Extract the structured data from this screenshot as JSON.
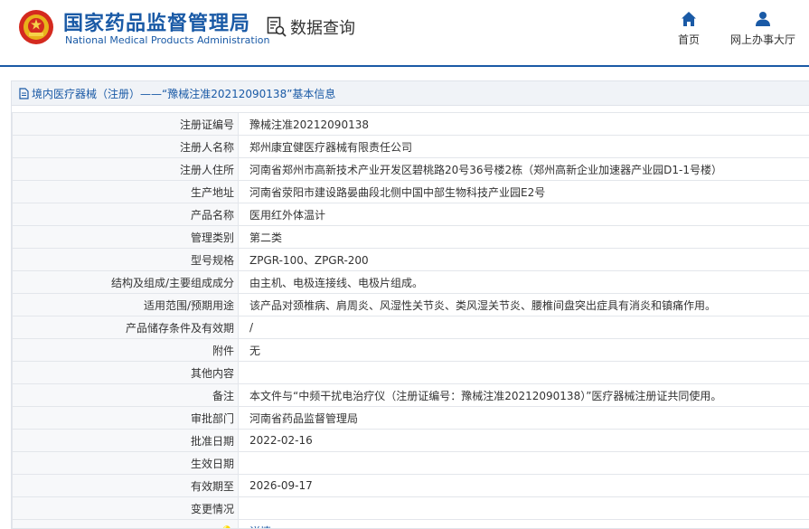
{
  "brand": {
    "name_cn": "国家药品监督管理局",
    "name_en": "National Medical Products Administration"
  },
  "header": {
    "data_query": "数据查询",
    "nav": [
      {
        "label": "首页",
        "icon": "home-icon"
      },
      {
        "label": "网上办事大厅",
        "icon": "user-icon"
      }
    ]
  },
  "panel": {
    "title": "境内医疗器械（注册）——“豫械注准20212090138”基本信息"
  },
  "colors": {
    "accent": "#1a5aa6",
    "label_bg": "#f7f8fa",
    "head_bg": "#f0f3f7"
  },
  "rows": [
    {
      "label": "注册证编号",
      "value": "豫械注准20212090138"
    },
    {
      "label": "注册人名称",
      "value": "郑州康宜健医疗器械有限责任公司"
    },
    {
      "label": "注册人住所",
      "value": "河南省郑州市高新技术产业开发区碧桃路20号36号楼2栋（郑州高新企业加速器产业园D1-1号楼）"
    },
    {
      "label": "生产地址",
      "value": "河南省荥阳市建设路晏曲段北侧中国中部生物科技产业园E2号"
    },
    {
      "label": "产品名称",
      "value": "医用红外体温计"
    },
    {
      "label": "管理类别",
      "value": "第二类"
    },
    {
      "label": "型号规格",
      "value": "ZPGR-100、ZPGR-200"
    },
    {
      "label": "结构及组成/主要组成成分",
      "value": "由主机、电极连接线、电极片组成。"
    },
    {
      "label": "适用范围/预期用途",
      "value": "该产品对颈椎病、肩周炎、风湿性关节炎、类风湿关节炎、腰椎间盘突出症具有消炎和镇痛作用。"
    },
    {
      "label": "产品储存条件及有效期",
      "value": "/"
    },
    {
      "label": "附件",
      "value": "无"
    },
    {
      "label": "其他内容",
      "value": ""
    },
    {
      "label": "备注",
      "value": "本文件与“中频干扰电治疗仪（注册证编号：豫械注准20212090138）”医疗器械注册证共同使用。"
    },
    {
      "label": "审批部门",
      "value": "河南省药品监督管理局"
    },
    {
      "label": "批准日期",
      "value": "2022-02-16"
    },
    {
      "label": "生效日期",
      "value": ""
    },
    {
      "label": "有效期至",
      "value": "2026-09-17"
    },
    {
      "label": "变更情况",
      "value": ""
    }
  ],
  "note_row": {
    "icon": "lightbulb-icon",
    "label_glyph": "💡",
    "link_text": "详情"
  }
}
